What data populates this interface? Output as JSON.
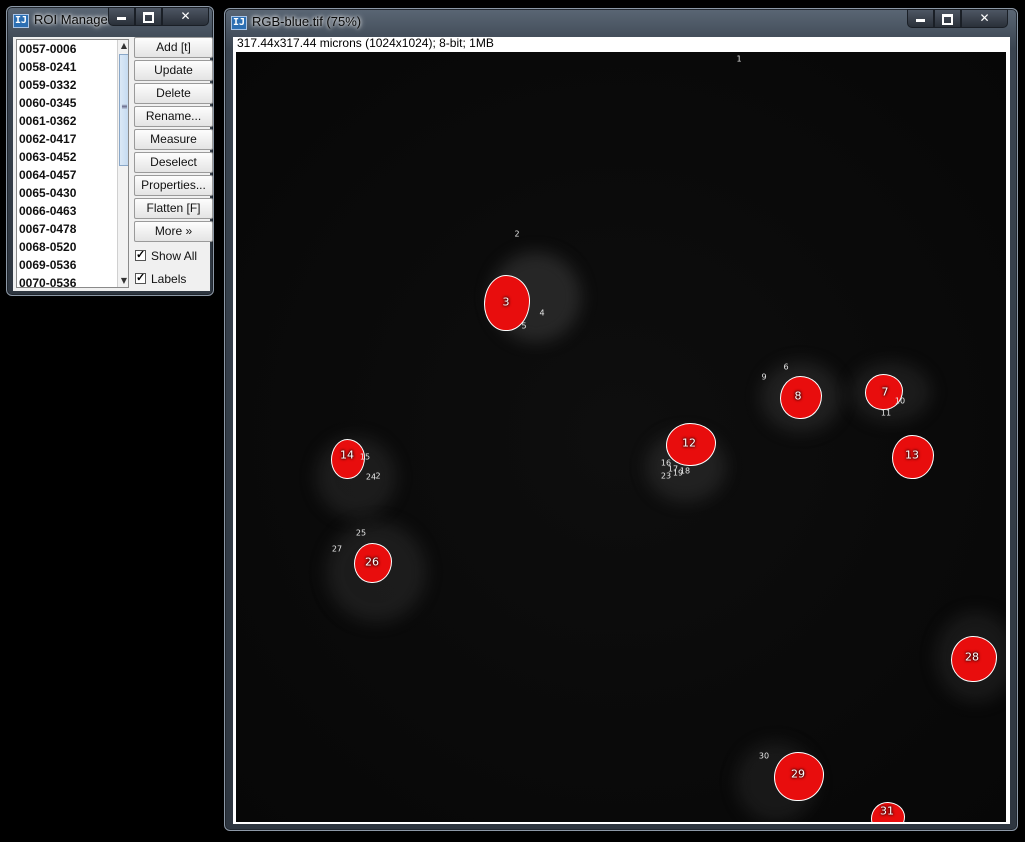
{
  "roi_manager": {
    "title": "ROI Manager",
    "icon": "imagej-icon",
    "list_items": [
      "0057-0006",
      "0058-0241",
      "0059-0332",
      "0060-0345",
      "0061-0362",
      "0062-0417",
      "0063-0452",
      "0064-0457",
      "0065-0430",
      "0066-0463",
      "0067-0478",
      "0068-0520",
      "0069-0536",
      "0070-0536"
    ],
    "buttons": {
      "add": "Add [t]",
      "update": "Update",
      "delete": "Delete",
      "rename": "Rename...",
      "measure": "Measure",
      "deselect": "Deselect",
      "properties": "Properties...",
      "flatten": "Flatten [F]",
      "more": "More »"
    },
    "checkboxes": {
      "show_all": {
        "label": "Show All",
        "checked": true
      },
      "labels": {
        "label": "Labels",
        "checked": true
      }
    }
  },
  "image_window": {
    "title": "RGB-blue.tif (75%)",
    "icon": "imagej-icon",
    "info": "317.44x317.44 microns (1024x1024); 8-bit; 1MB",
    "roi_labels": {
      "l1": "1",
      "l2": "2",
      "l3": "3",
      "l4": "4",
      "l5": "5",
      "l6": "6",
      "l7": "7",
      "l8": "8",
      "l9": "9",
      "l10": "10",
      "l11": "11",
      "l12": "12",
      "l13": "13",
      "l14": "14",
      "l15": "15",
      "l16": "16",
      "l17": "17",
      "l18": "18",
      "l19": "19",
      "l23": "23",
      "l24": "24",
      "l2b": "2",
      "l25": "25",
      "l26": "26",
      "l27": "27",
      "l28": "28",
      "l29": "29",
      "l30": "30",
      "l31": "31"
    }
  },
  "colors": {
    "roi_fill": "#e80d0d",
    "roi_outline": "#ffffff",
    "image_background": "#0a0a0a"
  }
}
